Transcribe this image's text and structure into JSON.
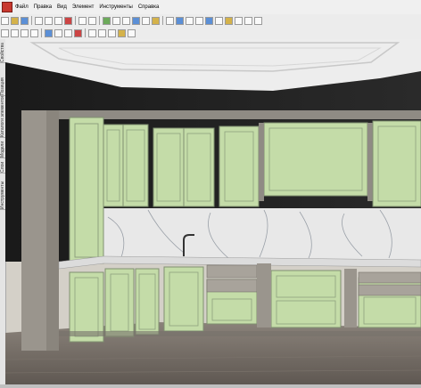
{
  "menu": {
    "items": [
      {
        "label": "Файл"
      },
      {
        "label": "Правка"
      },
      {
        "label": "Вид"
      },
      {
        "label": "Элемент"
      },
      {
        "label": "Инструменты"
      },
      {
        "label": "Справка"
      }
    ]
  },
  "sidebar": {
    "tabs": [
      {
        "label": "Свойства"
      },
      {
        "label": "Позиция"
      },
      {
        "label": "Каталоги элементов"
      },
      {
        "label": "Модели"
      },
      {
        "label": "Слои"
      },
      {
        "label": "Инструменты"
      }
    ]
  },
  "scene": {
    "colors": {
      "wall": "#1e1e1e",
      "ceiling": "#ececec",
      "cabinet_front": "#c4dca8",
      "cabinet_frame": "#8f8b84",
      "floor": "#6f6760",
      "backsplash": "#e6e6e6"
    }
  }
}
